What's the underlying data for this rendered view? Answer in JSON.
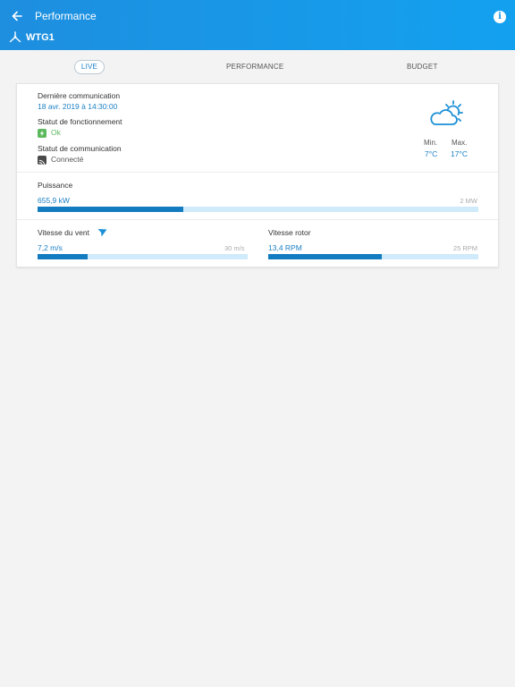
{
  "header": {
    "title": "Performance",
    "turbine_name": "WTG1"
  },
  "tabs": [
    {
      "label": "LIVE",
      "active": true
    },
    {
      "label": "PERFORMANCE",
      "active": false
    },
    {
      "label": "BUDGET",
      "active": false
    }
  ],
  "status": {
    "last_comm_label": "Dernière communication",
    "last_comm_value": "18 avr. 2019 à 14:30:00",
    "operating_label": "Statut de fonctionnement",
    "operating_value": "Ok",
    "comm_label": "Statut de communication",
    "comm_value": "Connecté"
  },
  "weather": {
    "icon": "partly-cloudy-icon",
    "min_label": "Min.",
    "min_value": "7°C",
    "max_label": "Max.",
    "max_value": "17°C"
  },
  "power": {
    "label": "Puissance",
    "value": "655,9 kW",
    "max": "2 MW",
    "fraction": 0.33
  },
  "wind": {
    "label": "Vitesse du vent",
    "value": "7,2 m/s",
    "max": "30 m/s",
    "fraction": 0.24
  },
  "rotor": {
    "label": "Vitesse rotor",
    "value": "13,4 RPM",
    "max": "25 RPM",
    "fraction": 0.54
  },
  "colors": {
    "appbar": "#1a98e8",
    "accent": "#1a7fc4",
    "bar_fill": "#137bc0",
    "bar_track": "#cfeafb",
    "ok": "#5cb85c"
  }
}
